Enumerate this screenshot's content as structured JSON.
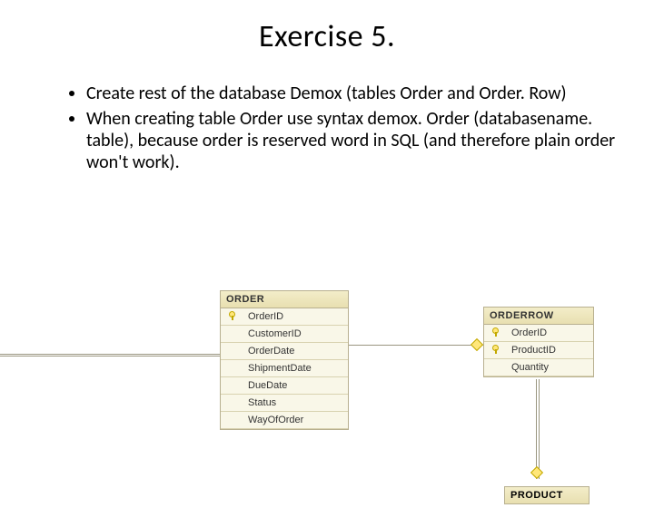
{
  "title": "Exercise 5.",
  "bullets": [
    "Create rest of the database Demox (tables Order and Order. Row)",
    "When creating table Order use syntax demox. Order (databasename. table), because order is reserved word in SQL (and therefore plain order won't work)."
  ],
  "tables": {
    "order": {
      "name": "ORDER",
      "cols": [
        {
          "pk": true,
          "name": "OrderID"
        },
        {
          "pk": false,
          "name": "CustomerID"
        },
        {
          "pk": false,
          "name": "OrderDate"
        },
        {
          "pk": false,
          "name": "ShipmentDate"
        },
        {
          "pk": false,
          "name": "DueDate"
        },
        {
          "pk": false,
          "name": "Status"
        },
        {
          "pk": false,
          "name": "WayOfOrder"
        }
      ]
    },
    "orderrow": {
      "name": "ORDERROW",
      "cols": [
        {
          "pk": true,
          "name": "OrderID"
        },
        {
          "pk": true,
          "name": "ProductID"
        },
        {
          "pk": false,
          "name": "Quantity"
        }
      ]
    },
    "product": {
      "name": "PRODUCT"
    }
  }
}
